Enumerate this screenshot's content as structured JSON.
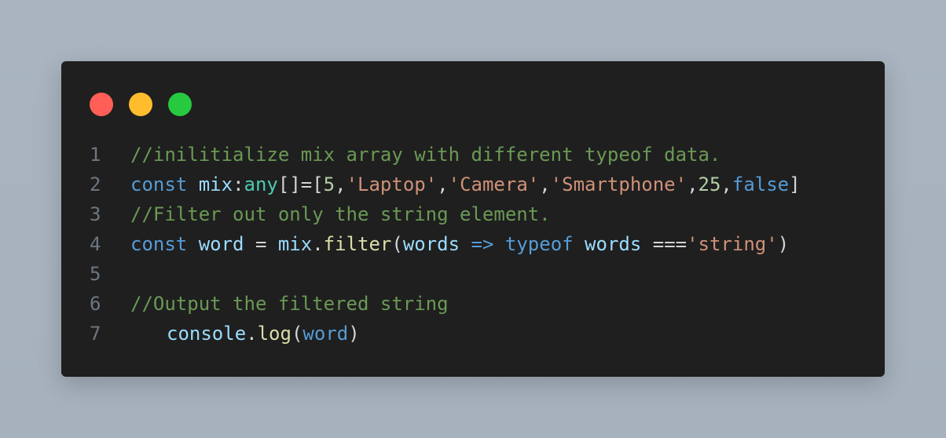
{
  "window": {
    "dots": [
      {
        "name": "close",
        "color": "#ff5f56"
      },
      {
        "name": "minimize",
        "color": "#ffbd2e"
      },
      {
        "name": "maximize",
        "color": "#27c93f"
      }
    ]
  },
  "code": {
    "line_numbers": [
      "1",
      "2",
      "3",
      "4",
      "5",
      "6",
      "7"
    ],
    "line1": {
      "comment": "//inilitialize mix array with different typeof data."
    },
    "line2": {
      "kw": "const",
      "var": "mix",
      "colon": ":",
      "type": "any",
      "bracket_eq": "[]=[",
      "num1": "5",
      "c1": ",",
      "s1": "'Laptop'",
      "c2": ",",
      "s2": "'Camera'",
      "c3": ",",
      "s3": "'Smartphone'",
      "c4": ",",
      "num2": "25",
      "c5": ",",
      "bool": "false",
      "close": "]"
    },
    "line3": {
      "comment": "//Filter out only the string element."
    },
    "line4": {
      "kw": "const",
      "var": "word",
      "eq": "=",
      "obj": "mix",
      "dot": ".",
      "fn": "filter",
      "paren_open": "(",
      "param": "words",
      "arrow": "=>",
      "typeof": "typeof",
      "param2": "words",
      "strict_eq": "===",
      "str": "'string'",
      "paren_close": ")"
    },
    "line5": {},
    "line6": {
      "comment": "//Output the filtered string"
    },
    "line7": {
      "obj": "console",
      "dot": ".",
      "fn": "log",
      "paren_open": "(",
      "arg": "word",
      "paren_close": ")"
    }
  }
}
